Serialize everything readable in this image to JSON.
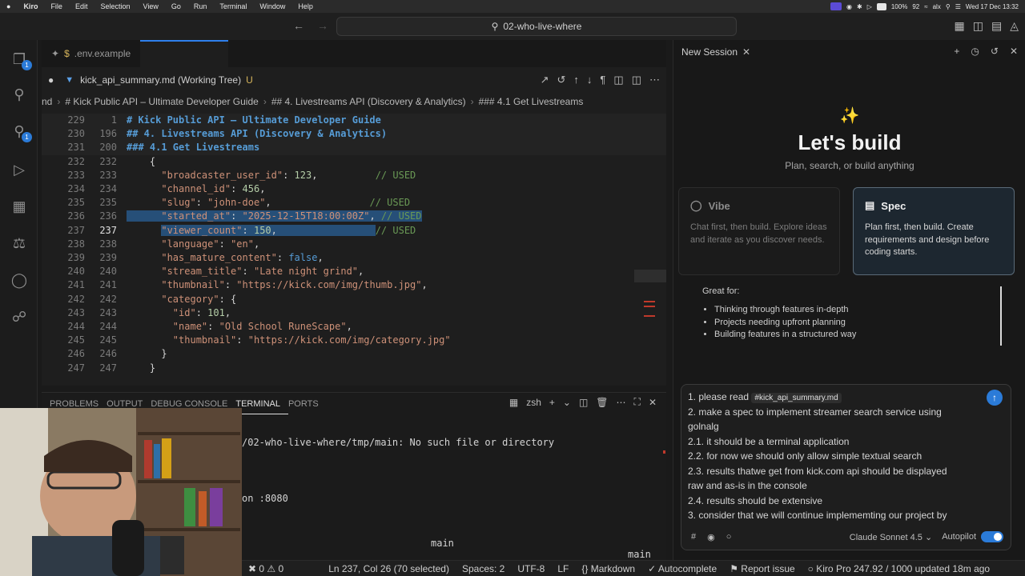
{
  "menubar": {
    "apple": "",
    "app": "Kiro",
    "items": [
      "File",
      "Edit",
      "Selection",
      "View",
      "Go",
      "Run",
      "Terminal",
      "Window",
      "Help"
    ],
    "battery": "100%",
    "battery_value": "92",
    "user": "alx",
    "datetime": "Wed 17 Dec 13:32"
  },
  "titlebar": {
    "search_text": "02-who-live-where"
  },
  "editor": {
    "pinned_tab": ".env.example",
    "active_tab": "kick_api_summary.md (Working Tree)",
    "active_tab_status": "U",
    "breadcrumb": [
      "nd",
      "# Kick Public API – Ultimate Developer Guide",
      "## 4. Livestreams API (Discovery & Analytics)",
      "### 4.1 Get Livestreams"
    ],
    "lines": [
      {
        "a": "229",
        "b": "1",
        "parts": [
          [
            "h",
            "# Kick Public API – Ultimate Developer Guide"
          ]
        ]
      },
      {
        "a": "230",
        "b": "196",
        "parts": [
          [
            "h",
            "## 4. Livestreams API (Discovery & Analytics)"
          ]
        ]
      },
      {
        "a": "231",
        "b": "200",
        "parts": [
          [
            "h",
            "### 4.1 Get Livestreams"
          ]
        ]
      },
      {
        "a": "232",
        "b": "232",
        "parts": [
          [
            "p",
            "    {"
          ]
        ]
      },
      {
        "a": "233",
        "b": "233",
        "parts": [
          [
            "p",
            "      "
          ],
          [
            "s",
            "\"broadcaster_user_id\""
          ],
          [
            "p",
            ": "
          ],
          [
            "n",
            "123"
          ],
          [
            "p",
            ",          "
          ],
          [
            "c",
            "// USED"
          ]
        ]
      },
      {
        "a": "234",
        "b": "234",
        "parts": [
          [
            "p",
            "      "
          ],
          [
            "s",
            "\"channel_id\""
          ],
          [
            "p",
            ": "
          ],
          [
            "n",
            "456"
          ],
          [
            "p",
            ","
          ]
        ]
      },
      {
        "a": "235",
        "b": "235",
        "parts": [
          [
            "p",
            "      "
          ],
          [
            "s",
            "\"slug\""
          ],
          [
            "p",
            ": "
          ],
          [
            "s",
            "\"john-doe\""
          ],
          [
            "p",
            ",                 "
          ],
          [
            "c",
            "// USED"
          ]
        ]
      },
      {
        "a": "236",
        "b": "236",
        "parts": [
          [
            "p",
            "      "
          ],
          [
            "s",
            "\"started_at\""
          ],
          [
            "p",
            ": "
          ],
          [
            "s",
            "\"2025-12-15T18:00:00Z\""
          ],
          [
            "p",
            ", "
          ],
          [
            "c",
            "// USED"
          ]
        ]
      },
      {
        "a": "237",
        "b": "237",
        "parts": [
          [
            "p",
            "      "
          ],
          [
            "s",
            "\"viewer_count\""
          ],
          [
            "p",
            ": "
          ],
          [
            "n",
            "150"
          ],
          [
            "p",
            ",                 "
          ],
          [
            "c",
            "// USED"
          ]
        ]
      },
      {
        "a": "238",
        "b": "238",
        "parts": [
          [
            "p",
            "      "
          ],
          [
            "s",
            "\"language\""
          ],
          [
            "p",
            ": "
          ],
          [
            "s",
            "\"en\""
          ],
          [
            "p",
            ","
          ]
        ]
      },
      {
        "a": "239",
        "b": "239",
        "parts": [
          [
            "p",
            "      "
          ],
          [
            "s",
            "\"has_mature_content\""
          ],
          [
            "p",
            ": "
          ],
          [
            "bool",
            "false"
          ],
          [
            "p",
            ","
          ]
        ]
      },
      {
        "a": "240",
        "b": "240",
        "parts": [
          [
            "p",
            "      "
          ],
          [
            "s",
            "\"stream_title\""
          ],
          [
            "p",
            ": "
          ],
          [
            "s",
            "\"Late night grind\""
          ],
          [
            "p",
            ","
          ]
        ]
      },
      {
        "a": "241",
        "b": "241",
        "parts": [
          [
            "p",
            "      "
          ],
          [
            "s",
            "\"thumbnail\""
          ],
          [
            "p",
            ": "
          ],
          [
            "s",
            "\"https://kick.com/img/thumb.jpg\""
          ],
          [
            "p",
            ","
          ]
        ]
      },
      {
        "a": "242",
        "b": "242",
        "parts": [
          [
            "p",
            "      "
          ],
          [
            "s",
            "\"category\""
          ],
          [
            "p",
            ": {"
          ]
        ]
      },
      {
        "a": "243",
        "b": "243",
        "parts": [
          [
            "p",
            "        "
          ],
          [
            "s",
            "\"id\""
          ],
          [
            "p",
            ": "
          ],
          [
            "n",
            "101"
          ],
          [
            "p",
            ","
          ]
        ]
      },
      {
        "a": "244",
        "b": "244",
        "parts": [
          [
            "p",
            "        "
          ],
          [
            "s",
            "\"name\""
          ],
          [
            "p",
            ": "
          ],
          [
            "s",
            "\"Old School RuneScape\""
          ],
          [
            "p",
            ","
          ]
        ]
      },
      {
        "a": "245",
        "b": "245",
        "parts": [
          [
            "p",
            "        "
          ],
          [
            "s",
            "\"thumbnail\""
          ],
          [
            "p",
            ": "
          ],
          [
            "s",
            "\"https://kick.com/img/category.jpg\""
          ]
        ]
      },
      {
        "a": "246",
        "b": "246",
        "parts": [
          [
            "p",
            "      }"
          ]
        ]
      },
      {
        "a": "247",
        "b": "247",
        "parts": [
          [
            "p",
            "    }"
          ]
        ]
      }
    ],
    "current_line": "237"
  },
  "panel": {
    "tabs": [
      "PROBLEMS",
      "OUTPUT",
      "DEBUG CONSOLE",
      "TERMINAL",
      "PORTS"
    ],
    "active_tab": "TERMINAL",
    "shell": "zsh",
    "terminal_lines": [
      "/02-who-live-where/tmp/main: No such file or directory",
      "on :8080",
      "main",
      "main"
    ]
  },
  "statusbar": {
    "errors": "0",
    "warnings": "0",
    "position": "Ln 237, Col 26 (70 selected)",
    "spaces": "Spaces: 2",
    "encoding": "UTF-8",
    "eol": "LF",
    "language": "Markdown",
    "autocomplete": "Autocomplete",
    "report": "Report issue",
    "plan": "Kiro Pro 247.92 / 1000 updated 18m ago"
  },
  "chat": {
    "session_title": "New Session",
    "hero_title": "Let's build",
    "hero_sub": "Plan, search, or build anything",
    "vibe": {
      "title": "Vibe",
      "desc": "Chat first, then build. Explore ideas and iterate as you discover needs."
    },
    "spec": {
      "title": "Spec",
      "desc": "Plan first, then build. Create requirements and design before coding starts."
    },
    "great_for_label": "Great for:",
    "great_for": [
      "Thinking through features in-depth",
      "Projects needing upfront planning",
      "Building features in a structured way"
    ],
    "prompt_prefix": "1. please read",
    "prompt_chip": "#kick_api_summary.md",
    "prompt_lines": [
      "2. make a spec to implement streamer search service using",
      "golnalg",
      "2.1. it should be a terminal application",
      "2.2. for now we should only allow simple textual search",
      "2.3. results thatwe get from kick.com api should be displayed",
      "raw and as-is in the console",
      "2.4. results should be extensive",
      "3. consider that we will continue implememting our project by"
    ],
    "model": "Claude Sonnet 4.5",
    "autopilot": "Autopilot",
    "autopilot_on": true
  },
  "colors": {
    "accent": "#2b7bd8",
    "selection": "#264f78",
    "string": "#ce9178",
    "comment": "#6a9955"
  }
}
